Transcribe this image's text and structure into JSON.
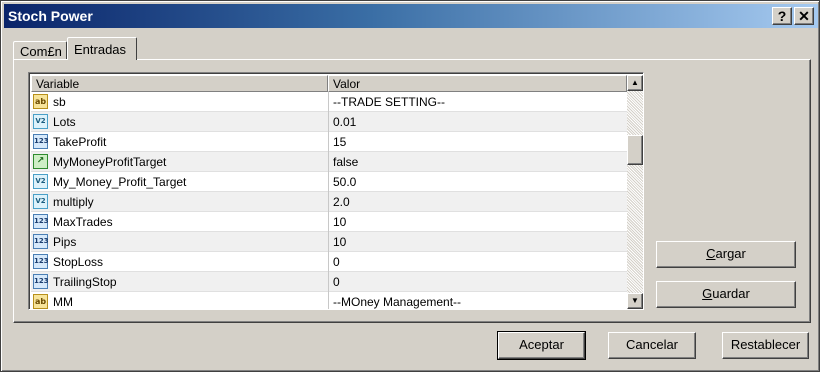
{
  "window": {
    "title": "Stoch Power",
    "help_button": "?",
    "close_button": "✕"
  },
  "tabs": [
    {
      "label": "Com£n"
    },
    {
      "label": "Entradas"
    }
  ],
  "grid": {
    "headers": {
      "variable": "Variable",
      "value": "Valor"
    },
    "rows": [
      {
        "icon": "ab",
        "type": "string",
        "variable": "sb",
        "value": "--TRADE SETTING--"
      },
      {
        "icon": "V2",
        "type": "double",
        "variable": "Lots",
        "value": "0.01"
      },
      {
        "icon": "123",
        "type": "int",
        "variable": "TakeProfit",
        "value": "15"
      },
      {
        "icon": "↗",
        "type": "bool",
        "variable": "MyMoneyProfitTarget",
        "value": "false"
      },
      {
        "icon": "V2",
        "type": "double",
        "variable": "My_Money_Profit_Target",
        "value": "50.0"
      },
      {
        "icon": "V2",
        "type": "double",
        "variable": "multiply",
        "value": "2.0"
      },
      {
        "icon": "123",
        "type": "int",
        "variable": "MaxTrades",
        "value": "10"
      },
      {
        "icon": "123",
        "type": "int",
        "variable": "Pips",
        "value": "10"
      },
      {
        "icon": "123",
        "type": "int",
        "variable": "StopLoss",
        "value": "0"
      },
      {
        "icon": "123",
        "type": "int",
        "variable": "TrailingStop",
        "value": "0"
      },
      {
        "icon": "ab",
        "type": "string",
        "variable": "MM",
        "value": "--MOney Management--"
      }
    ]
  },
  "side_buttons": {
    "load_prefix": "C",
    "load_rest": "argar",
    "save_prefix": "G",
    "save_rest": "uardar"
  },
  "footer_buttons": {
    "ok": "Aceptar",
    "cancel": "Cancelar",
    "reset": "Restablecer"
  },
  "colors": {
    "title_bar_start": "#0a246a",
    "title_bar_end": "#a6caf0",
    "dialog_face": "#d4d0c8"
  }
}
